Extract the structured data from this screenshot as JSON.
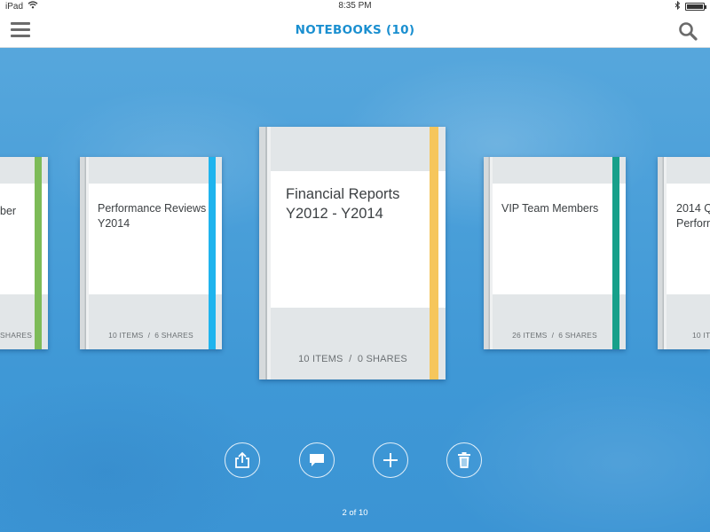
{
  "status_bar": {
    "device": "iPad",
    "time": "8:35 PM"
  },
  "navbar": {
    "title": "NOTEBOOKS (10)",
    "menu_icon": "hamburger-menu-icon",
    "search_icon": "search-icon"
  },
  "notebooks": [
    {
      "title": "ber",
      "meta": "SHARES",
      "band_color": "#7dbb58"
    },
    {
      "title": "Performance Reviews\nY2014",
      "meta": "10 ITEMS  /  6 SHARES",
      "band_color": "#1fb4ee"
    },
    {
      "title": "Financial Reports\nY2012 - Y2014",
      "meta": "10 ITEMS  /  0 SHARES",
      "band_color": "#f6c65c"
    },
    {
      "title": "VIP Team Members",
      "meta": "26 ITEMS  /  6 SHARES",
      "band_color": "#17a08a"
    },
    {
      "title": "2014 Q\nPerform",
      "meta": "10 IT",
      "band_color": "#9aa3a8"
    }
  ],
  "toolbar": {
    "share_icon": "share-icon",
    "comment_icon": "comment-icon",
    "add_icon": "add-icon",
    "delete_icon": "trash-icon"
  },
  "pager": {
    "text": "2 of 10"
  }
}
